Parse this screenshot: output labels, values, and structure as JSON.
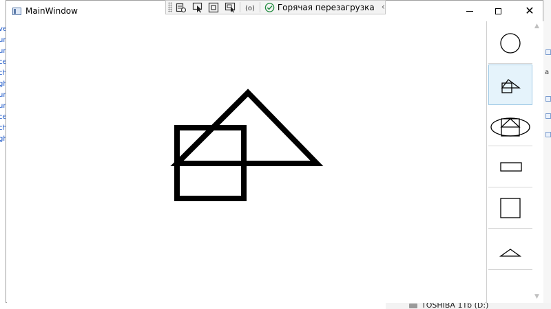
{
  "window": {
    "title": "MainWindow"
  },
  "debug_toolbar": {
    "hot_reload_label": "Горячая перезагрузка",
    "status_color": "#1e8a3c",
    "buttons": [
      "select-element-icon",
      "go-to-live-tree-icon",
      "track-focus-icon",
      "display-adorners-icon",
      "binding-failures-icon"
    ]
  },
  "caption_buttons": {
    "minimize": "minimize",
    "maximize": "maximize",
    "close": "✕"
  },
  "canvas": {
    "drawing": "square and triangle outline drawn in thick black strokes",
    "stroke_color": "#000000"
  },
  "shapes_list": {
    "items": [
      {
        "name": "circle",
        "selected": false
      },
      {
        "name": "square-triangle",
        "selected": true
      },
      {
        "name": "ellipse-composite",
        "selected": false
      },
      {
        "name": "rectangle",
        "selected": false
      },
      {
        "name": "square",
        "selected": false
      },
      {
        "name": "triangle",
        "selected": false
      }
    ],
    "selected_bg": "#e5f3fb"
  },
  "background": {
    "left_fragments": [
      "ve",
      "ur",
      "ur",
      "ce",
      "ch",
      "gh",
      "ur",
      "ur",
      "ce",
      "ch",
      "gh"
    ],
    "right_fragments": [
      "в",
      "а"
    ],
    "drive_label": "TOSHIBA 1Tb (D:)"
  }
}
